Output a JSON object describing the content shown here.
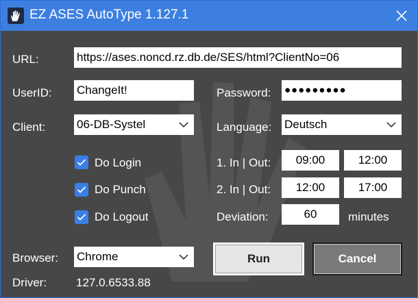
{
  "window": {
    "title": "EZ ASES AutoType 1.127.1",
    "close_icon": "close-icon",
    "app_icon": "hand-icon"
  },
  "colors": {
    "titlebar": "#3c7fe0",
    "background": "#474747",
    "checkbox": "#3a7ee6"
  },
  "form": {
    "url_label": "URL:",
    "url_value": "https://ases.noncd.rz.db.de/SES/html?ClientNo=06",
    "userid_label": "UserID:",
    "userid_value": "ChangeIt!",
    "password_label": "Password:",
    "password_value": "●●●●●●●●●",
    "client_label": "Client:",
    "client_value": "06-DB-Systel",
    "language_label": "Language:",
    "language_value": "Deutsch",
    "do_login_label": "Do Login",
    "do_punch_label": "Do Punch",
    "do_logout_label": "Do Logout",
    "do_login_checked": true,
    "do_punch_checked": true,
    "do_logout_checked": true,
    "in_out_1_label": "1. In | Out:",
    "in_1": "09:00",
    "out_1": "12:00",
    "in_out_2_label": "2. In | Out:",
    "in_2": "12:00",
    "out_2": "17:00",
    "deviation_label": "Deviation:",
    "deviation_value": "60",
    "deviation_unit": "minutes",
    "browser_label": "Browser:",
    "browser_value": "Chrome",
    "driver_label": "Driver:",
    "driver_value": "127.0.6533.88"
  },
  "buttons": {
    "run_label": "Run",
    "cancel_label": "Cancel"
  }
}
